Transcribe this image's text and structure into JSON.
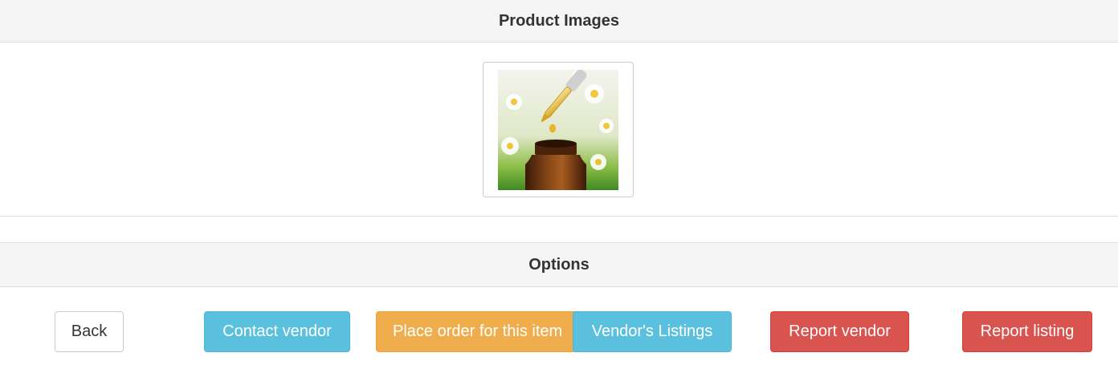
{
  "images_panel": {
    "title": "Product Images",
    "thumbnail_icon": "product-photo-oil-dropper"
  },
  "options_panel": {
    "title": "Options",
    "buttons": {
      "back": "Back",
      "contact_vendor": "Contact vendor",
      "place_order": "Place order for this item",
      "vendor_listings": "Vendor's Listings",
      "report_vendor": "Report vendor",
      "report_listing": "Report listing"
    }
  },
  "colors": {
    "info": "#5bc0de",
    "warning": "#f0ad4e",
    "danger": "#d9534f",
    "heading_bg": "#f5f5f5"
  }
}
